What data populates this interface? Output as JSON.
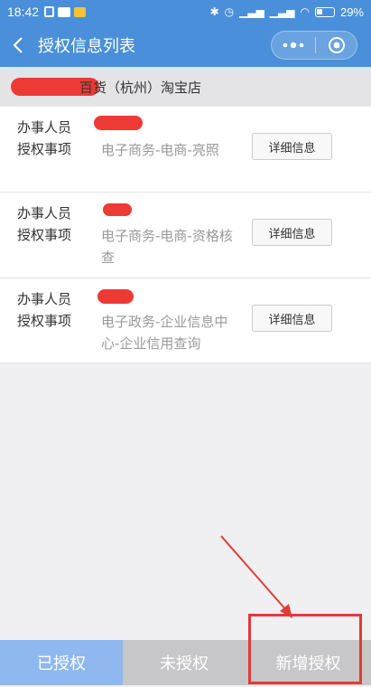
{
  "status_bar": {
    "time": "18:42",
    "battery": "29%",
    "icons": [
      "lock-icon",
      "message-icon",
      "note-icon",
      "bluetooth-icon",
      "alarm-icon",
      "signal-icon",
      "wifi-icon",
      "battery-icon"
    ]
  },
  "header": {
    "title": "授权信息列表",
    "more_icon": "more-dots-icon",
    "close_icon": "target-circle-icon"
  },
  "shop": {
    "name_visible": "百货（杭州）淘宝店"
  },
  "list": {
    "items": [
      {
        "agent_label": "办事人员",
        "matter_label": "授权事项",
        "matter": "电子商务-电商-亮照",
        "button": "详细信息"
      },
      {
        "agent_label": "办事人员",
        "matter_label": "授权事项",
        "matter": "电子商务-电商-资格核查",
        "button": "详细信息"
      },
      {
        "agent_label": "办事人员",
        "matter_label": "授权事项",
        "matter": "电子政务-企业信息中心-企业信用查询",
        "button": "详细信息"
      }
    ]
  },
  "tabs": [
    {
      "label": "已授权",
      "active": true
    },
    {
      "label": "未授权",
      "active": false
    },
    {
      "label": "新增授权",
      "active": false
    }
  ],
  "colors": {
    "primary": "#4a8fd9",
    "active_tab": "#8eb8ef",
    "inactive_tab": "#c7c7c9",
    "annotation_red": "#e23b34"
  }
}
